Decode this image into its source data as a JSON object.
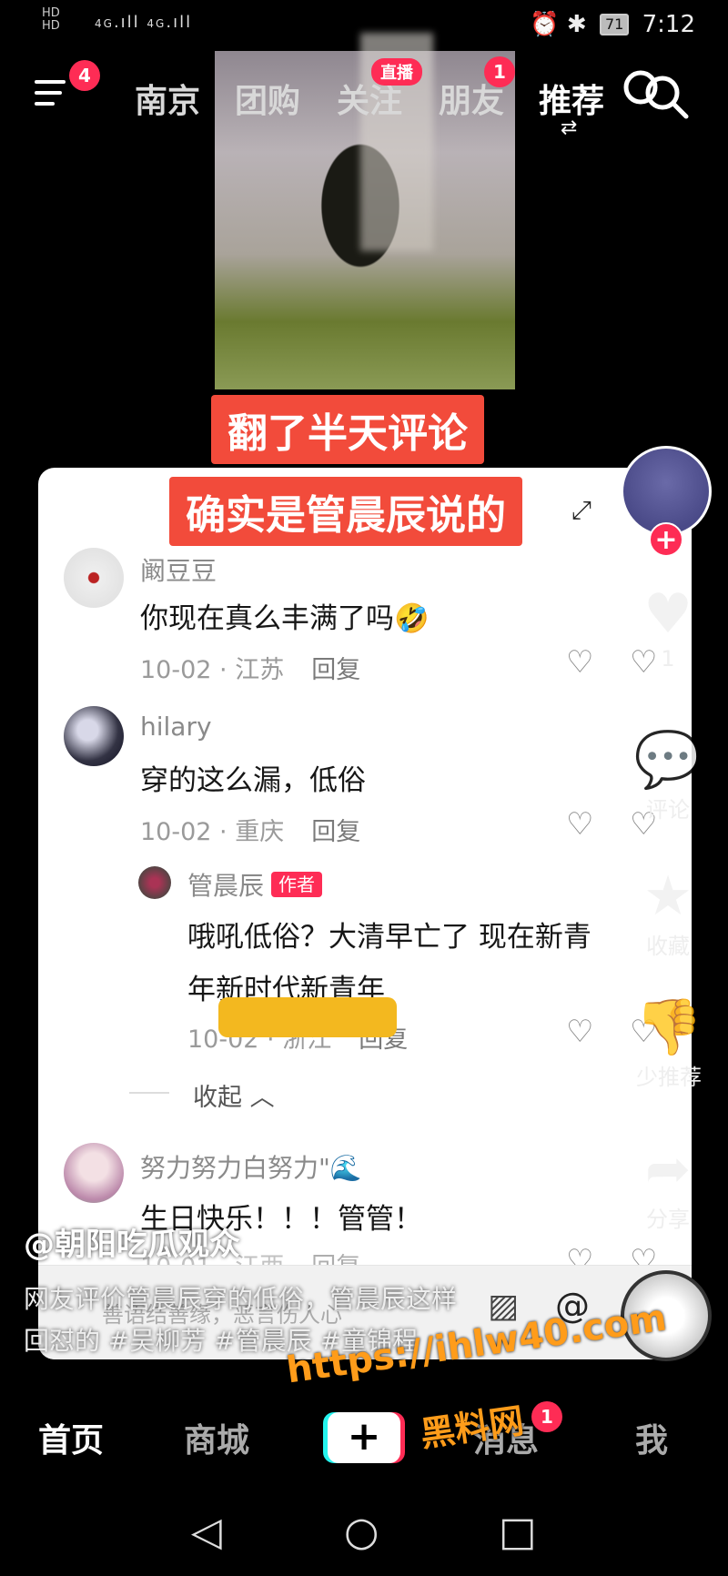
{
  "status": {
    "hd1": "HD",
    "hd2": "HD",
    "net1": "4G",
    "net2": "4G",
    "battery": "71",
    "time": "7:12"
  },
  "topnav": {
    "menu_badge": "4",
    "tabs": [
      {
        "label": "南京"
      },
      {
        "label": "团购"
      },
      {
        "label": "关注"
      },
      {
        "label": "朋友"
      },
      {
        "label": "推荐"
      }
    ],
    "live_badge": "直播",
    "friends_badge": "1"
  },
  "captions": {
    "line1": "翻了半天评论",
    "line2": "确实是管晨辰说的"
  },
  "comments": [
    {
      "user": "阚豆豆",
      "text": "你现在真么丰满了吗🤣",
      "date": "10-02",
      "region": "江苏",
      "reply": "回复"
    },
    {
      "user": "hilary",
      "text": "穿的这么漏，低俗",
      "date": "10-02",
      "region": "重庆",
      "reply": "回复"
    },
    {
      "user": "管晨辰",
      "author_tag": "作者",
      "text_line1": "哦吼低俗？大清早亡了 现在新青",
      "text_line2": "年新时代新青年",
      "date": "10-02",
      "region": "浙江",
      "reply": "回复"
    },
    {
      "user": "努力努力白努力\"🌊",
      "text": "生日快乐！！！管管！",
      "date": "10-01",
      "region": "江西",
      "reply": "回复"
    }
  ],
  "collapse": "收起",
  "input": {
    "placeholder": "善语结善缘，恶言伤人心"
  },
  "rail": {
    "like_count": "1",
    "comment_label": "评论",
    "fav_label": "收藏",
    "dislike_label": "少推荐",
    "share_label": "分享"
  },
  "post": {
    "author": "@朝阳吃瓜观众",
    "desc_line1": "网友评价管晨辰穿的低俗，管晨辰这样",
    "desc_line2": "回怼的 #吴柳芳 #管晨辰 #童锦程"
  },
  "bottomnav": {
    "home": "首页",
    "mall": "商城",
    "plus": "+",
    "messages": "消息",
    "messages_badge": "1",
    "me": "我"
  },
  "watermark": {
    "url": "https://ihlw40.com",
    "name": "黑料网"
  },
  "colors": {
    "accent": "#fe2c55",
    "caption_bg": "#f24b3b",
    "watermark": "#ff9c1a"
  }
}
